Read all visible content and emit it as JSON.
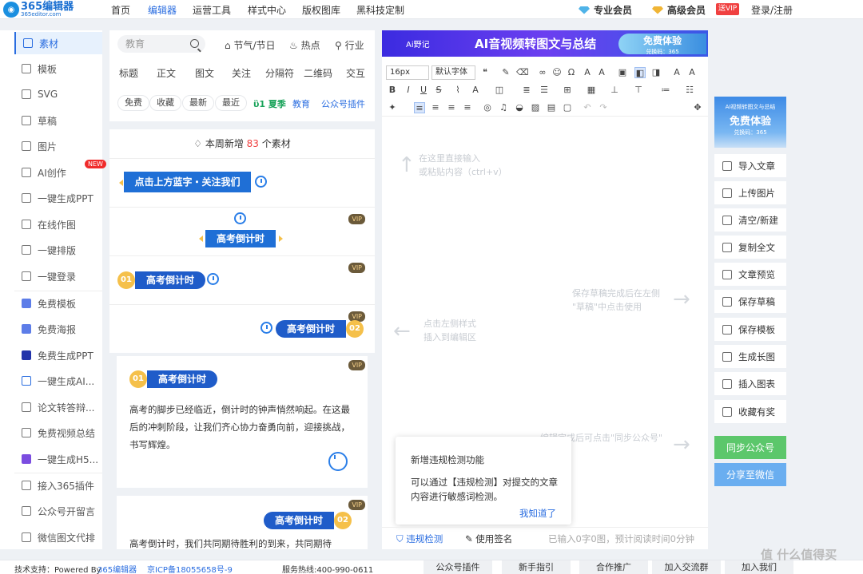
{
  "topbar": {
    "logo_main": "365编辑器",
    "logo_sub": "365editor.com",
    "nav": [
      "首页",
      "编辑器",
      "运营工具",
      "样式中心",
      "版权图库",
      "黑科技定制"
    ],
    "active": "编辑器",
    "member_pro": "专业会员",
    "member_senior": "高级会员",
    "vip_badge": "送VIP",
    "login": "登录/注册"
  },
  "leftnav": {
    "items": [
      "素材",
      "模板",
      "SVG",
      "草稿",
      "图片",
      "AI创作",
      "一键生成PPT",
      "在线作图",
      "一键排版",
      "一键登录",
      "免费模板",
      "免费海报",
      "免费生成PPT",
      "一键生成AI...",
      "论文转答辩...",
      "免费视频总结",
      "一键生成H5...",
      "接入365插件",
      "公众号开留言",
      "微信图文代排"
    ],
    "new_badge": "NEW"
  },
  "materials": {
    "search_placeholder": "教育",
    "top_tabs": [
      "节气/节日",
      "热点",
      "行业"
    ],
    "categories": [
      "标题",
      "正文",
      "图文",
      "关注",
      "分隔符",
      "二维码",
      "交互"
    ],
    "filters": [
      "免费",
      "收藏",
      "最新",
      "最近"
    ],
    "tag_season": "夏季",
    "tag_edu": "教育",
    "tag_plugin": "公众号插件",
    "weekly_prefix": "本周新增",
    "weekly_count": "83",
    "weekly_suffix": "个素材",
    "vip": "VIP",
    "card1_title": "点击上方蓝字・关注我们",
    "card_title": "高考倒计时",
    "num1": "01",
    "num2": "02",
    "body1": "高考的脚步已经临近，倒计时的钟声悄然响起。在这最后的冲刺阶段，让我们齐心协力奋勇向前，迎接挑战，书写辉煌。",
    "body2": "高考倒计时，我们共同期待胜利的到来，共同期待"
  },
  "editor": {
    "ai_logo": "Ai野记",
    "banner_title": "AI音视频转图文与总结",
    "banner_cta": "免费体验",
    "banner_code": "兑换码：365",
    "font_size": "16px",
    "font_family": "默认字体",
    "hint_input": "在这里直接输入\n或粘贴内容（ctrl+v）",
    "hint_save": "保存草稿完成后在左侧\n\"草稿\"中点击使用",
    "hint_insert": "点击左侧样式\n插入到编辑区",
    "hint_sync": "编辑完成后可点击\"同步公众号\"\n至微信\"",
    "notice_title": "新增违规检测功能",
    "notice_body": "可以通过【违规检测】对提交的文章内容进行敏感词检测。",
    "notice_ok": "我知道了",
    "status_check": "违规检测",
    "status_sign": "使用签名",
    "status_count": "已输入0字0图，预计阅读时间0分钟"
  },
  "rightcol": {
    "ad_small": "AI视频转图文与总结",
    "ad_big": "免费体验",
    "ad_code": "兑换码：365",
    "buttons": [
      "导入文章",
      "上传图片",
      "清空/新建",
      "复制全文",
      "文章预览",
      "保存草稿",
      "保存模板",
      "生成长图",
      "插入图表",
      "收藏有奖"
    ],
    "sync": "同步公众号",
    "share": "分享至微信",
    "colors": {
      "sync": "#5cc76b",
      "share": "#6aaef0"
    }
  },
  "footer": {
    "support_label": "技术支持：Powered By",
    "support_link": "365编辑器",
    "icp": "京ICP备18055658号-9",
    "hotline": "服务热线:400-990-0611",
    "buttons": [
      "公众号插件",
      "新手指引",
      "合作推广",
      "加入交流群",
      "加入我们"
    ],
    "watermark": "值 什么值得买"
  }
}
